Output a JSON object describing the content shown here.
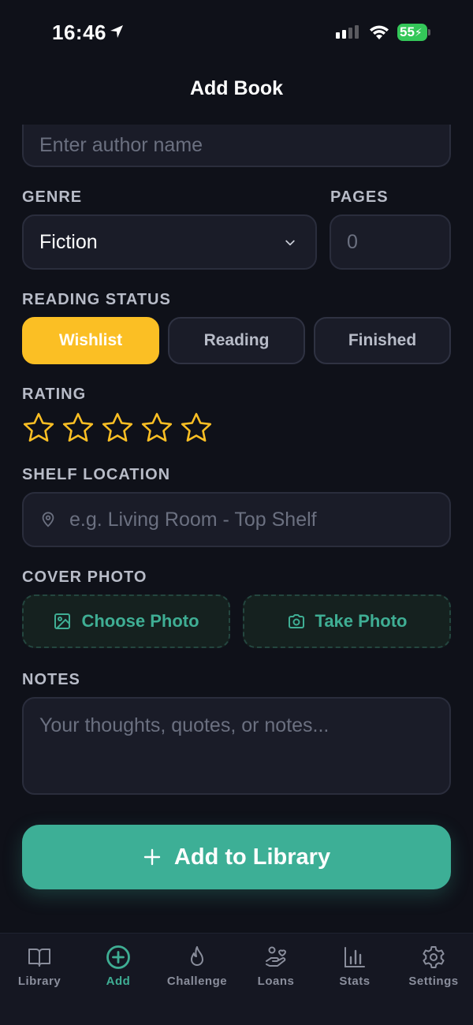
{
  "status": {
    "time": "16:46",
    "battery": "55"
  },
  "header": {
    "title": "Add Book"
  },
  "form": {
    "author_placeholder": "Enter author name",
    "genre_label": "GENRE",
    "genre_value": "Fiction",
    "pages_label": "PAGES",
    "pages_placeholder": "0",
    "reading_status_label": "READING STATUS",
    "status_options": [
      "Wishlist",
      "Reading",
      "Finished"
    ],
    "status_selected": "Wishlist",
    "rating_label": "RATING",
    "rating": {
      "value": 0,
      "max": 5
    },
    "shelf_label": "SHELF LOCATION",
    "shelf_placeholder": "e.g. Living Room - Top Shelf",
    "cover_label": "COVER PHOTO",
    "choose_photo": "Choose Photo",
    "take_photo": "Take Photo",
    "notes_label": "NOTES",
    "notes_placeholder": "Your thoughts, quotes, or notes...",
    "submit_label": "Add to Library"
  },
  "tabs": [
    {
      "label": "Library",
      "icon": "book-icon"
    },
    {
      "label": "Add",
      "icon": "plus-circle-icon",
      "active": true
    },
    {
      "label": "Challenge",
      "icon": "flame-icon"
    },
    {
      "label": "Loans",
      "icon": "hand-heart-icon"
    },
    {
      "label": "Stats",
      "icon": "bar-chart-icon"
    },
    {
      "label": "Settings",
      "icon": "gear-icon"
    }
  ],
  "colors": {
    "background": "#0f1119",
    "accent": "#3daf96",
    "selected_status": "#fbbf24",
    "star": "#fbbf24"
  }
}
